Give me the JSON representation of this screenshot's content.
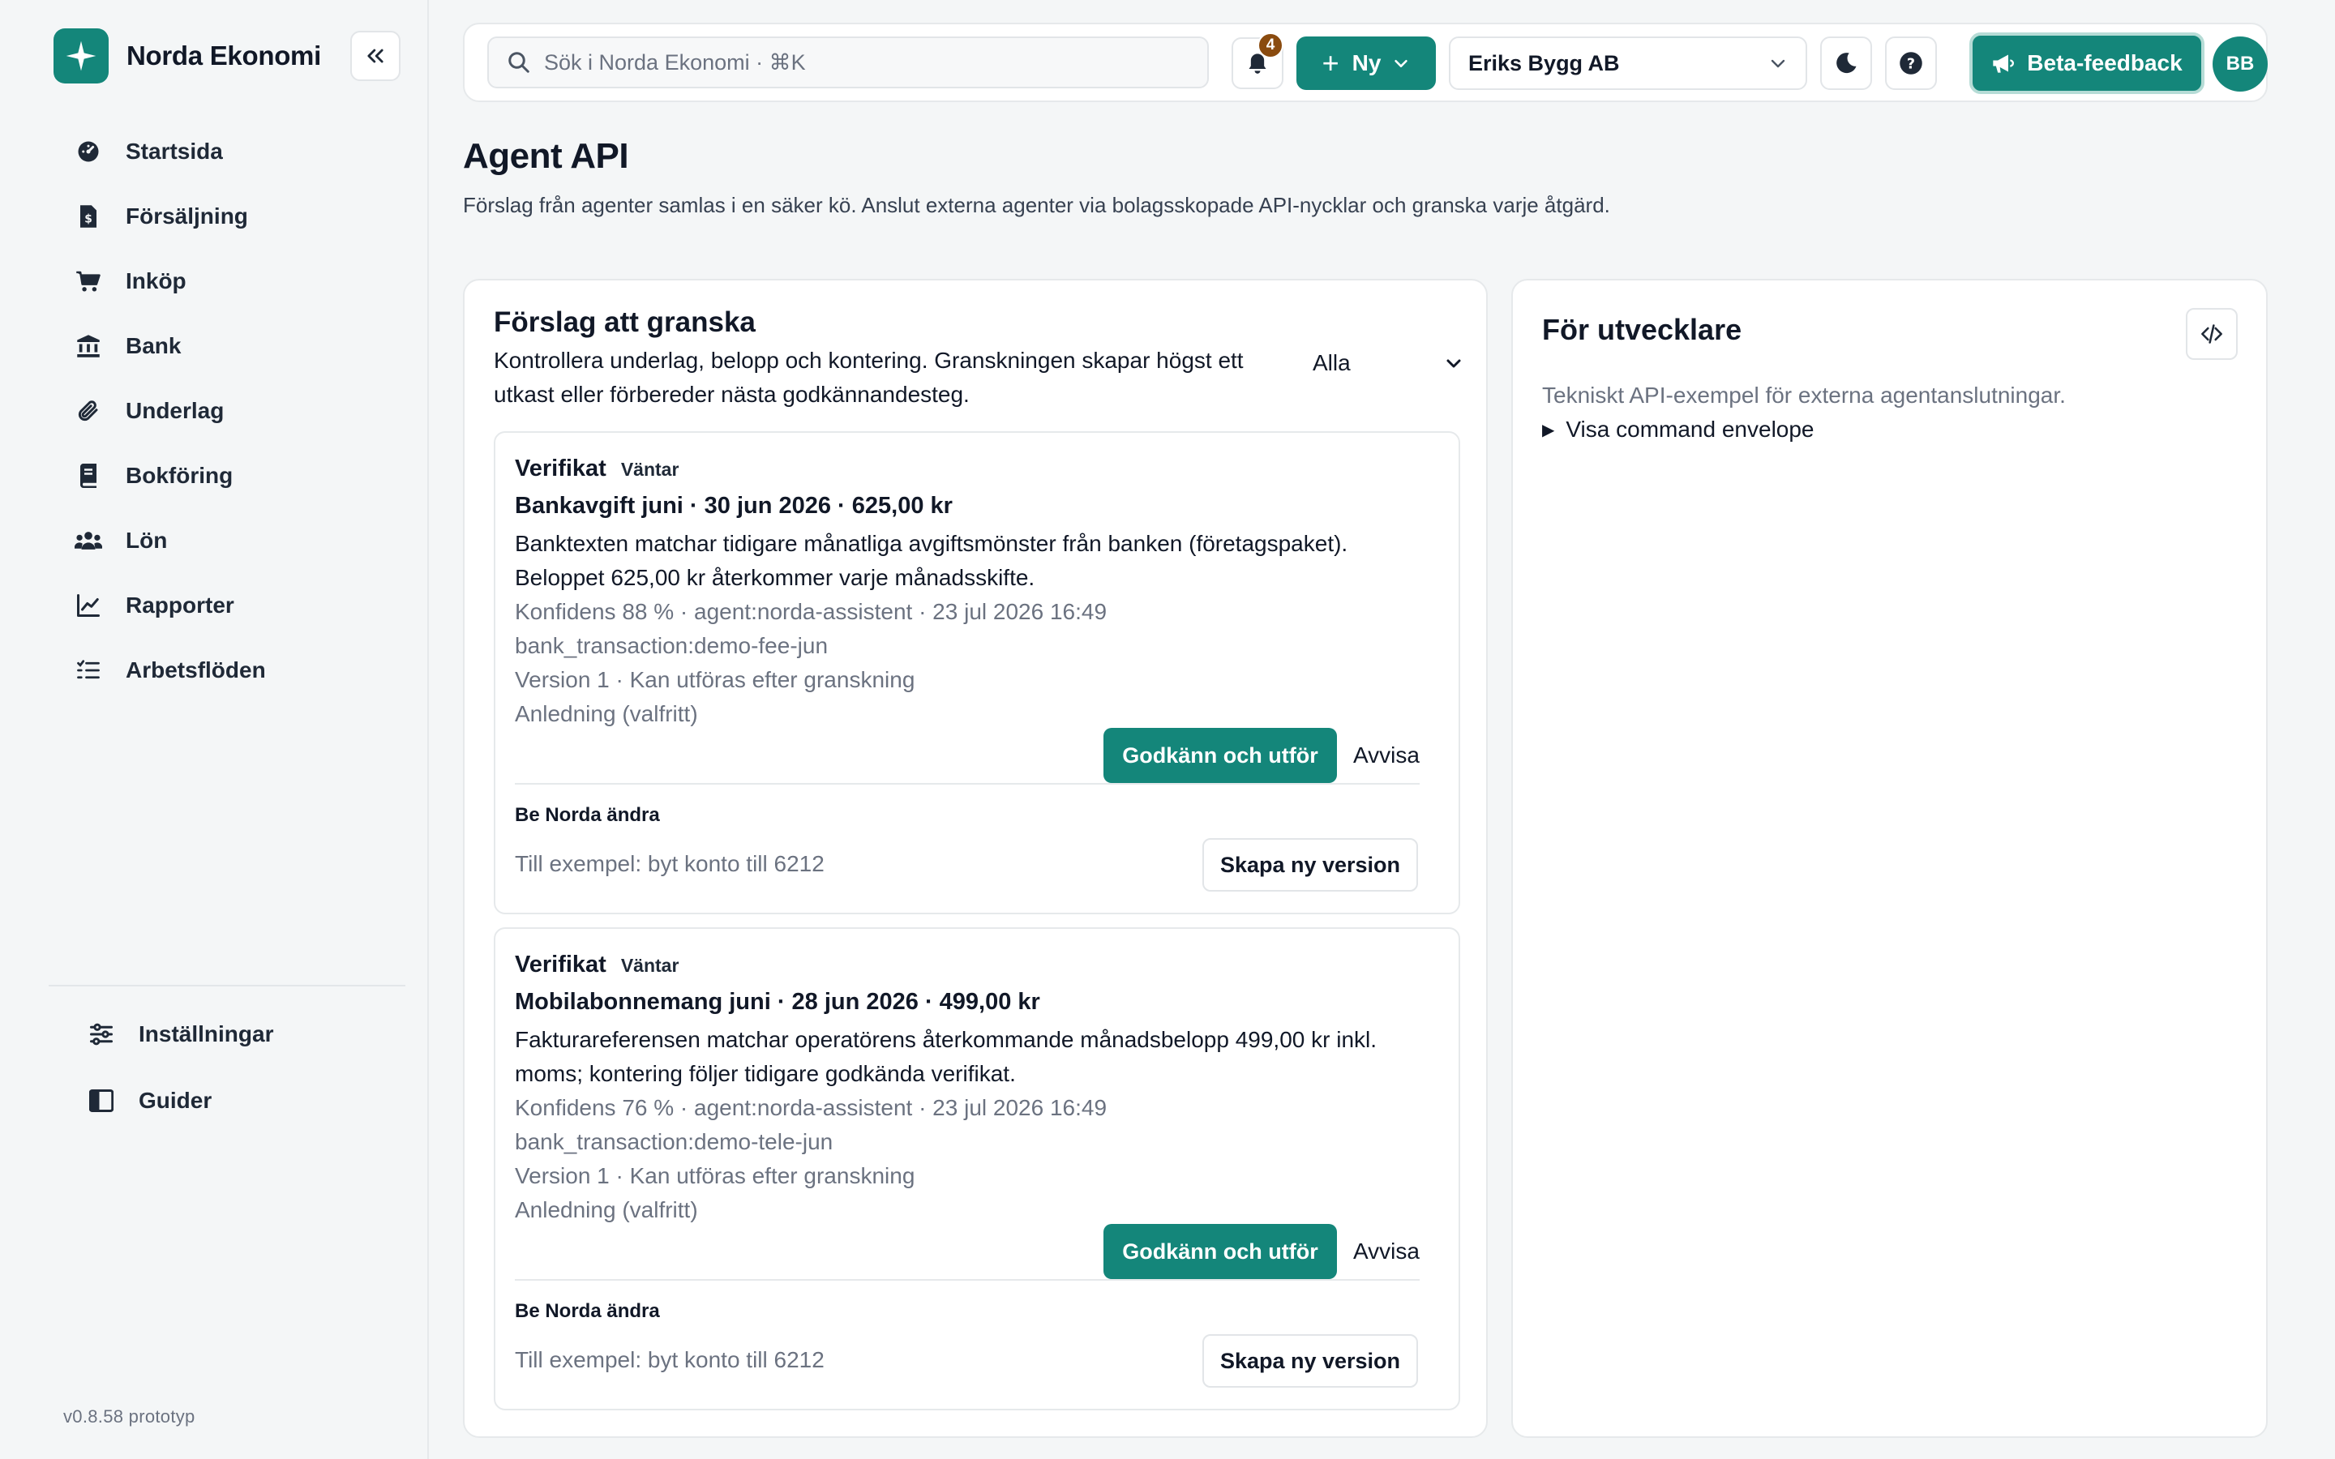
{
  "brand": {
    "name": "Norda Ekonomi"
  },
  "sidebar": {
    "items": [
      {
        "label": "Startsida",
        "icon": "dashboard-icon"
      },
      {
        "label": "Försäljning",
        "icon": "invoice-icon"
      },
      {
        "label": "Inköp",
        "icon": "cart-icon"
      },
      {
        "label": "Bank",
        "icon": "bank-icon"
      },
      {
        "label": "Underlag",
        "icon": "paperclip-icon"
      },
      {
        "label": "Bokföring",
        "icon": "book-icon"
      },
      {
        "label": "Lön",
        "icon": "users-icon"
      },
      {
        "label": "Rapporter",
        "icon": "chart-icon"
      },
      {
        "label": "Arbetsflöden",
        "icon": "list-icon"
      }
    ],
    "bottom_items": [
      {
        "label": "Inställningar",
        "icon": "sliders-icon"
      },
      {
        "label": "Guider",
        "icon": "guide-book-icon"
      }
    ],
    "version": "v0.8.58 prototyp"
  },
  "topbar": {
    "search_placeholder": "Sök i Norda Ekonomi · ⌘K",
    "notification_count": "4",
    "new_label": "Ny",
    "company": "Eriks Bygg AB",
    "feedback_label": "Beta-feedback",
    "avatar_initials": "BB"
  },
  "page": {
    "title": "Agent API",
    "subtitle": "Förslag från agenter samlas i en säker kö. Anslut externa agenter via bolagsskopade API-nycklar och granska varje åtgärd."
  },
  "review": {
    "title": "Förslag att granska",
    "description": "Kontrollera underlag, belopp och kontering. Granskningen skapar högst ett utkast eller förbereder nästa godkännandesteg.",
    "filter_value": "Alla",
    "cards": [
      {
        "type": "Verifikat",
        "status": "Väntar",
        "title": "Bankavgift juni · 30 jun 2026 · 625,00 kr",
        "body": "Banktexten matchar tidigare månatliga avgiftsmönster från banken (företagspaket). Beloppet 625,00 kr återkommer varje månadsskifte.",
        "confidence_line": "Konfidens 88 % · agent:norda-assistent · 23 jul 2026 16:49",
        "reference": "bank_transaction:demo-fee-jun",
        "version_line": "Version 1 · Kan utföras efter granskning",
        "reason_placeholder": "Anledning (valfritt)",
        "approve_label": "Godkänn och utför",
        "reject_label": "Avvisa",
        "ask_label": "Be Norda ändra",
        "ask_placeholder": "Till exempel: byt konto till 6212",
        "new_version_label": "Skapa ny version"
      },
      {
        "type": "Verifikat",
        "status": "Väntar",
        "title": "Mobilabonnemang juni · 28 jun 2026 · 499,00 kr",
        "body": "Fakturareferensen matchar operatörens återkommande månadsbelopp 499,00 kr inkl. moms; kontering följer tidigare godkända verifikat.",
        "confidence_line": "Konfidens 76 % · agent:norda-assistent · 23 jul 2026 16:49",
        "reference": "bank_transaction:demo-tele-jun",
        "version_line": "Version 1 · Kan utföras efter granskning",
        "reason_placeholder": "Anledning (valfritt)",
        "approve_label": "Godkänn och utför",
        "reject_label": "Avvisa",
        "ask_label": "Be Norda ändra",
        "ask_placeholder": "Till exempel: byt konto till 6212",
        "new_version_label": "Skapa ny version"
      }
    ]
  },
  "developer": {
    "title": "För utvecklare",
    "description": "Tekniskt API-exempel för externa agentanslutningar.",
    "toggle_label": "Visa command envelope"
  },
  "colors": {
    "accent": "#14867a",
    "badge": "#8a4b0f",
    "muted": "#6b7280"
  }
}
